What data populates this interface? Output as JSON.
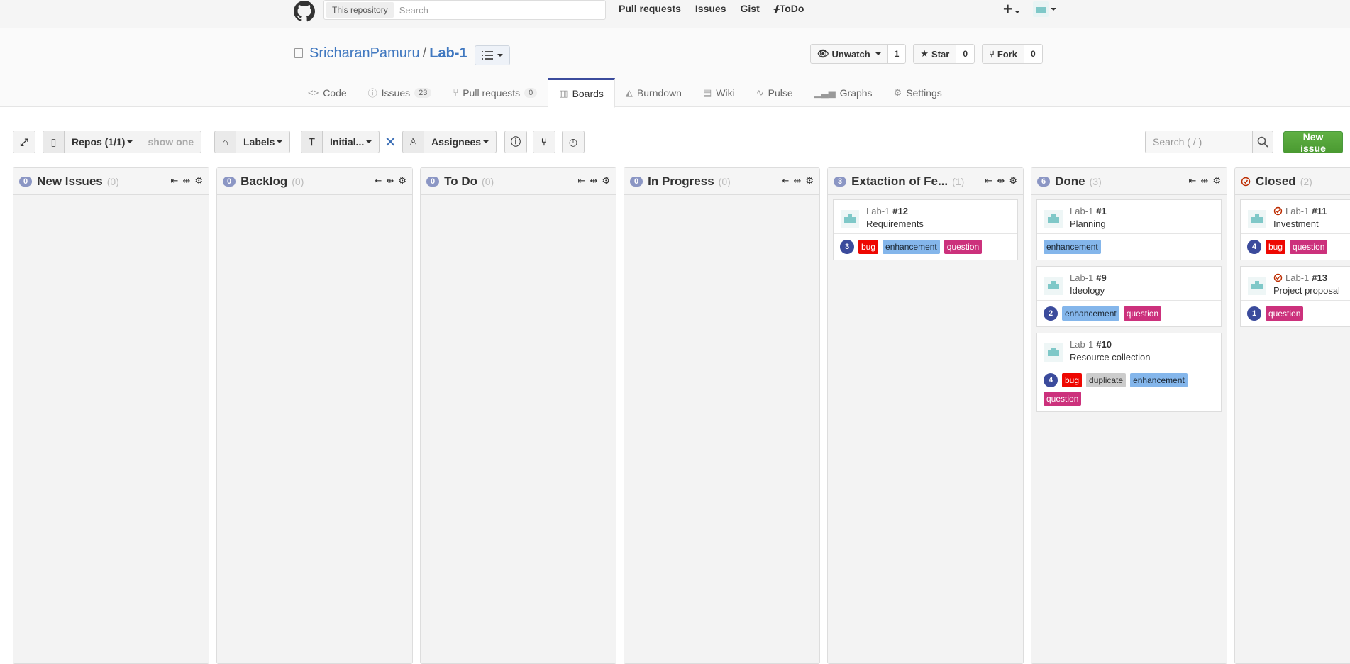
{
  "header": {
    "search_scope": "This repository",
    "search_placeholder": "Search",
    "nav": [
      "Pull requests",
      "Issues",
      "Gist",
      "ToDo"
    ]
  },
  "repo": {
    "owner": "SricharanPamuru",
    "separator": "/",
    "name": "Lab-1",
    "watch_label": "Unwatch",
    "watch_count": "1",
    "star_label": "Star",
    "star_count": "0",
    "fork_label": "Fork",
    "fork_count": "0"
  },
  "tabs": [
    {
      "label": "Code",
      "icon": "code-icon"
    },
    {
      "label": "Issues",
      "icon": "issue-icon",
      "badge": "23"
    },
    {
      "label": "Pull requests",
      "icon": "pull-request-icon",
      "badge": "0"
    },
    {
      "label": "Boards",
      "icon": "boards-icon",
      "active": true
    },
    {
      "label": "Burndown",
      "icon": "burndown-icon"
    },
    {
      "label": "Wiki",
      "icon": "wiki-icon"
    },
    {
      "label": "Pulse",
      "icon": "pulse-icon"
    },
    {
      "label": "Graphs",
      "icon": "graphs-icon"
    },
    {
      "label": "Settings",
      "icon": "gear-icon"
    }
  ],
  "toolbar": {
    "repos_label": "Repos (1/1)",
    "show_one": "show one",
    "labels_label": "Labels",
    "milestone_label": "Initial...",
    "assignees_label": "Assignees",
    "search_placeholder": "Search ( / )",
    "new_issue": "New issue"
  },
  "columns": [
    {
      "count": "0",
      "title": "New Issues",
      "sub": "(0)",
      "cards": []
    },
    {
      "count": "0",
      "title": "Backlog",
      "sub": "(0)",
      "cards": []
    },
    {
      "count": "0",
      "title": "To Do",
      "sub": "(0)",
      "cards": []
    },
    {
      "count": "0",
      "title": "In Progress",
      "sub": "(0)",
      "cards": []
    },
    {
      "count": "3",
      "title": "Extaction of Fe...",
      "sub": "(1)",
      "cards": [
        {
          "repo": "Lab-1",
          "number": "#12",
          "title": "Requirements",
          "badge": "3",
          "closed": false,
          "labels": [
            "bug",
            "enhancement",
            "question"
          ]
        }
      ]
    },
    {
      "count": "6",
      "title": "Done",
      "sub": "(3)",
      "cards": [
        {
          "repo": "Lab-1",
          "number": "#1",
          "title": "Planning",
          "badge": "",
          "closed": false,
          "labels": [
            "enhancement"
          ]
        },
        {
          "repo": "Lab-1",
          "number": "#9",
          "title": "Ideology",
          "badge": "2",
          "closed": false,
          "labels": [
            "enhancement",
            "question"
          ]
        },
        {
          "repo": "Lab-1",
          "number": "#10",
          "title": "Resource collection",
          "badge": "4",
          "closed": false,
          "labels": [
            "bug",
            "duplicate",
            "enhancement",
            "question"
          ]
        }
      ]
    },
    {
      "count": "",
      "title": "Closed",
      "sub": "(2)",
      "closed": true,
      "cards": [
        {
          "repo": "Lab-1",
          "number": "#11",
          "title": "Investment",
          "badge": "4",
          "closed": true,
          "labels": [
            "bug",
            "question"
          ]
        },
        {
          "repo": "Lab-1",
          "number": "#13",
          "title": "Project proposal",
          "badge": "1",
          "closed": true,
          "labels": [
            "question"
          ]
        }
      ]
    }
  ],
  "label_colors": {
    "bug": "#ee0701",
    "enhancement": "#84b6eb",
    "question": "#cc317c",
    "duplicate": "#cccccc"
  }
}
